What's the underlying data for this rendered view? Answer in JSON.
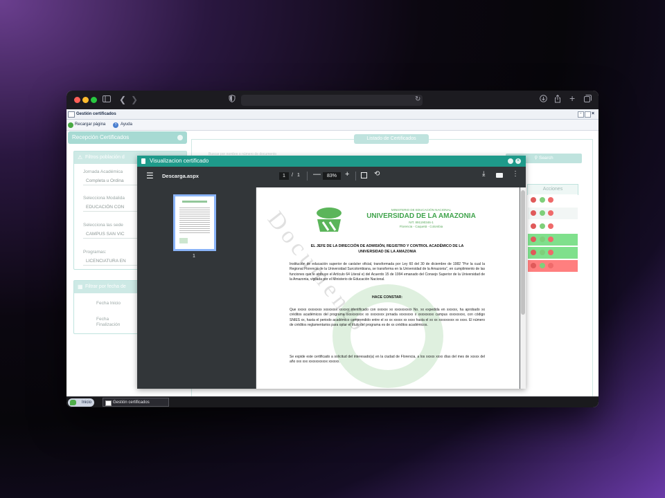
{
  "browser": {
    "reload_icon": "reload-icon"
  },
  "app": {
    "title": "Gestión certificados",
    "toolbar": {
      "reload_label": "Recargar página",
      "help_label": "Ayuda"
    }
  },
  "left_panel": {
    "header": "Recepción Certificados",
    "filters_title": "Filtros población d",
    "fields": [
      {
        "label": "Jornada Académica",
        "value": "Completa u Ordina"
      },
      {
        "label": "Selecciona Modalida",
        "value": "EDUCACIÓN CON"
      },
      {
        "label": "Selecciona las sede",
        "value": "CAMPUS SAN VIC"
      },
      {
        "label": "Programas:",
        "value": "LICENCIATURA EN"
      }
    ],
    "date_title": "Filtrar por fecha de",
    "date_fields": {
      "start_label": "Fecha Inicio",
      "end_label_1": "Fecha",
      "end_label_2": "Finalización"
    }
  },
  "right_panel": {
    "title": "Listado de Certificados",
    "search_label": "Search",
    "search_hint": "Buscar por nombre o número de documento",
    "actions_header": "Acciones",
    "row_colors": [
      "#ffffff",
      "#f2f6f5",
      "#ffffff",
      "#7fe08c",
      "#7fe08c",
      "#ff7f7f"
    ]
  },
  "modal": {
    "title": "Visualizacion certificado",
    "pdf": {
      "filename": "Descarga.aspx",
      "page_current": "1",
      "page_total": "1",
      "zoom": "83%",
      "thumb_page_number": "1"
    },
    "document": {
      "ministry": "MINISTERIO DE EDUCACIÓN NACIONAL",
      "university": "UNIVERSIDAD DE LA AMAZONIA",
      "nit": "NIT. 891190346-1",
      "city": "Florencia - Caquetá - Colombia",
      "heading_line1": "EL JEFE DE LA DIRECCIÓN DE ADMISIÓN, REGISTRO Y CONTROL ACADÉMICO DE LA",
      "heading_line2": "UNIVERSIDAD DE LA AMAZONIA",
      "paragraph1": "Institución de educación superior de carácter oficial, transformada por Ley 60 del 30 de diciembre de 1982 \"Por la cual la Regional Florencia de la Universidad Surcolombiana, se transforma en la Universidad de la Amazonia\", en cumplimiento de las funciones que le atribuye el Artículo 64 Literal e) del Acuerdo 15 de 1994 emanado del Consejo Superior de la Universidad de la Amazonia, vigilada por el Ministerio de Educación Nacional.",
      "hace_constar": "HACE CONSTAR:",
      "paragraph2": "Que xxxxx xxxxxxxx xxxxxxxx xxxxxx identificado con xxxxxx xx xxxxxxxxxx No. xx expedida en xxxxxx, ha aprobado xx créditos académicos del programa xxxxxxxxxx xx xxxxxxxx jornada xxxxxxxx x xxxxxxxxx campus xxxxxxxxx, con código SNIES xx, hasta el periodo académico comprendido entre el xx xx xxxxx xx xxxx hasta el xx xx xxxxxxxxx xx xxxx. El número de créditos reglamentarios para optar el título del programa es de xx créditos académicos.",
      "paragraph3": "Se expide este certificado a solicitud del interesado(a) en la ciudad de Florencia, a los xxxxx xxxx días del mes de xxxxx del año xxx xxx xxxxxxxxxxx xxxxxx.",
      "watermark": "Documento"
    }
  },
  "taskbar": {
    "start_label": "Inicio",
    "task_label": "Gestión certificados"
  },
  "colors": {
    "teal": "#1e9a8a",
    "teal_light": "#a7dad3",
    "pdf_dark": "#323639",
    "logo_green": "#5bb55a"
  }
}
